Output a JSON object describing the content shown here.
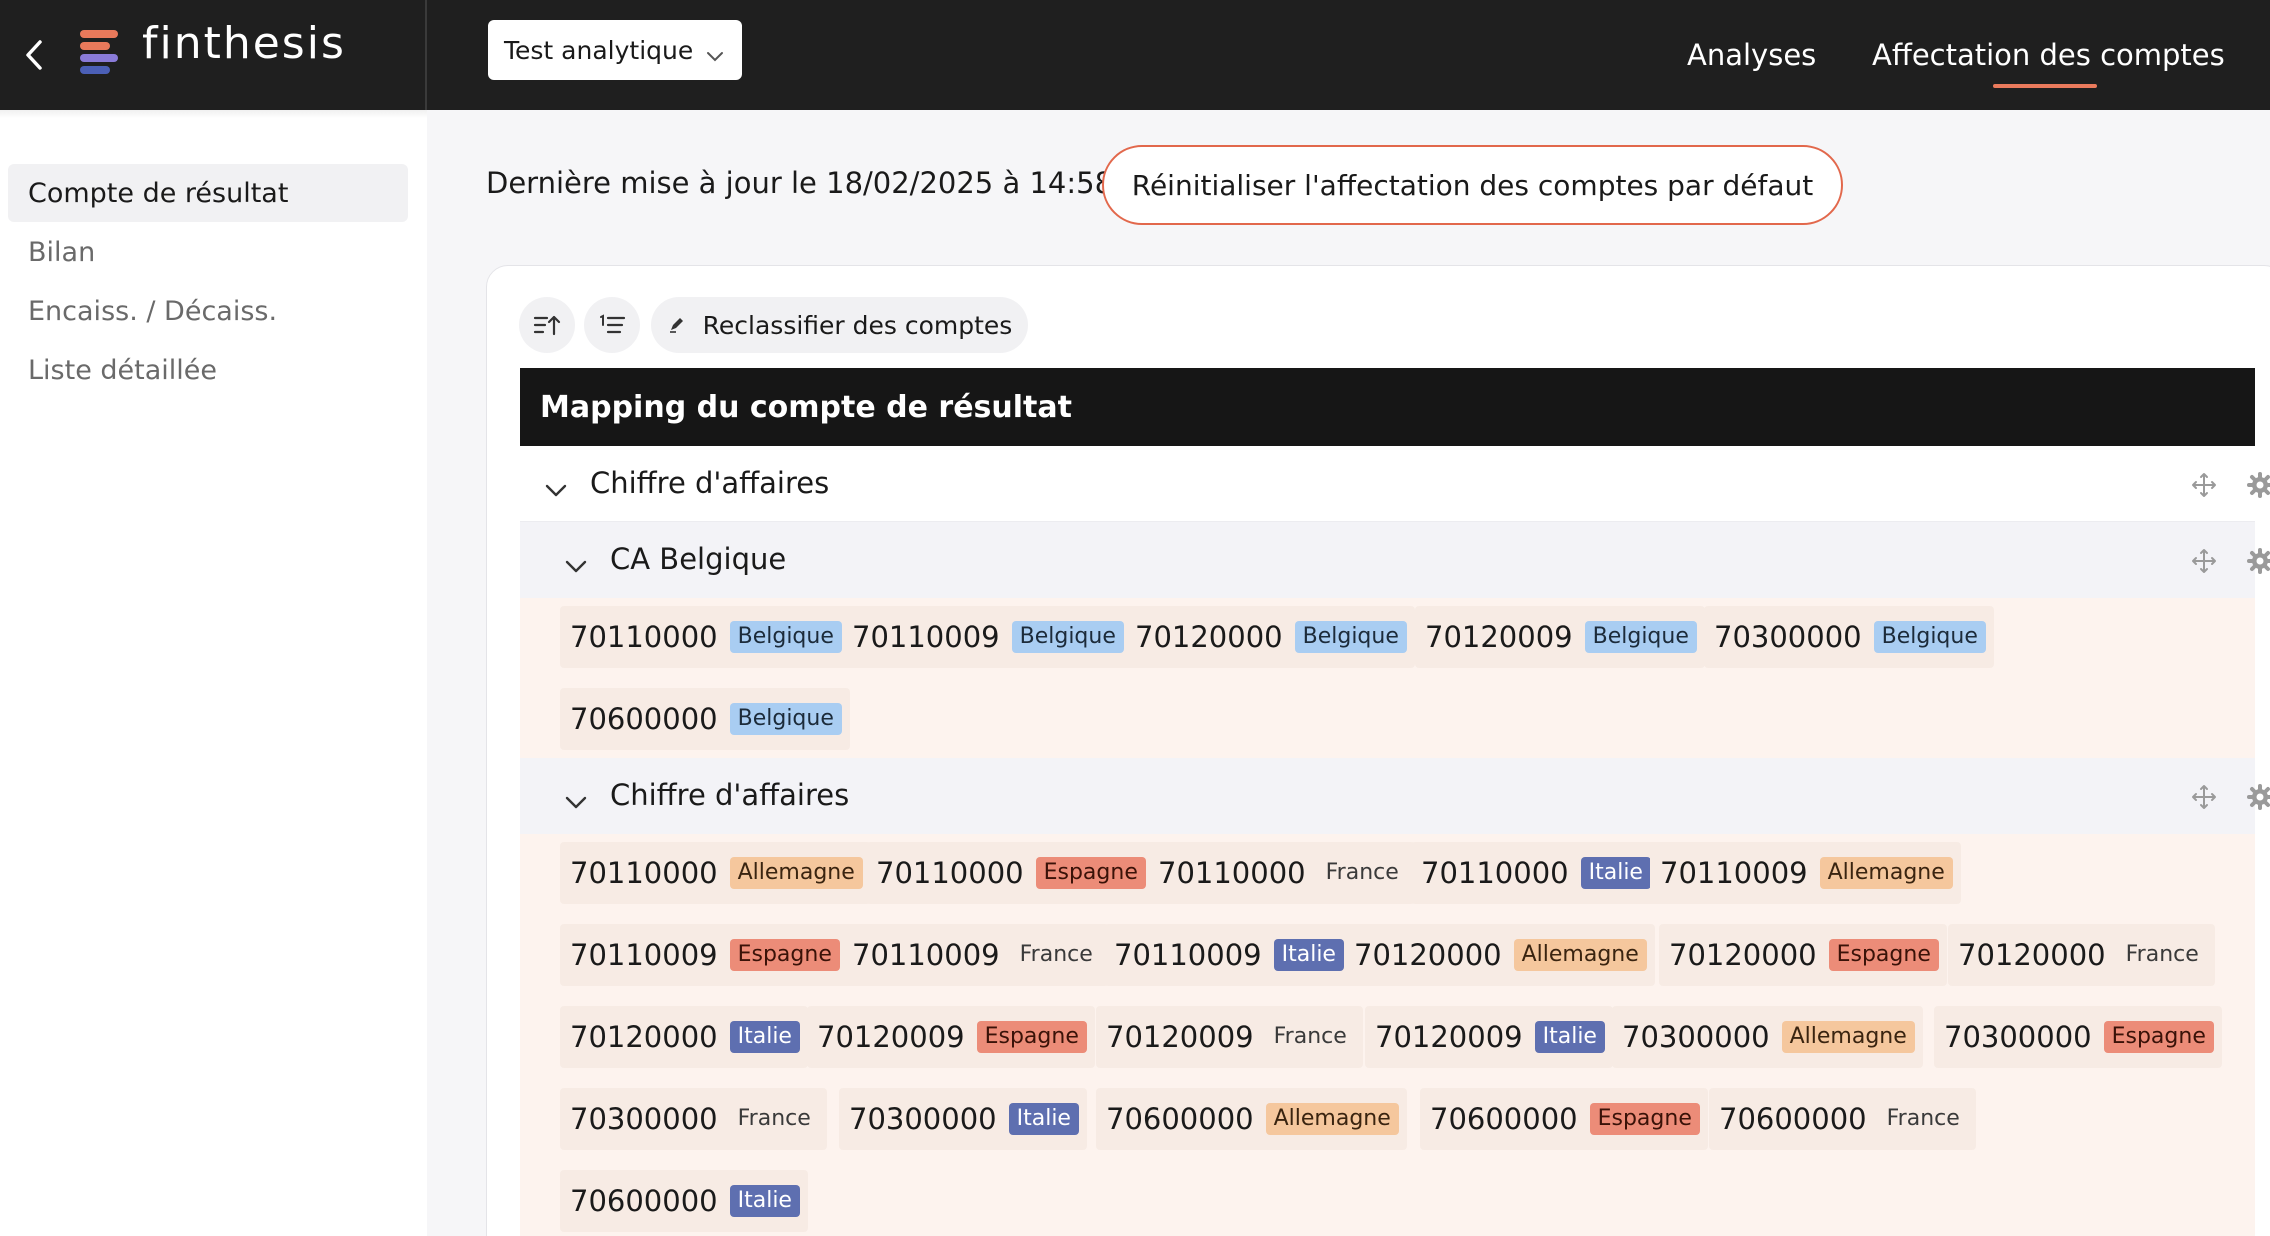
{
  "header": {
    "brand": "finthesis",
    "selector_value": "Test analytique",
    "nav": [
      "Analyses",
      "Affectation des comptes"
    ],
    "active_nav": "Affectation des comptes",
    "logo_colors": [
      "#e9795b",
      "#8a7bd8",
      "#4b5fb6"
    ],
    "accent_color": "#ea7a5c"
  },
  "sidebar": {
    "items": [
      {
        "label": "Compte de résultat",
        "active": true
      },
      {
        "label": "Bilan",
        "active": false
      },
      {
        "label": "Encaiss. / Décaiss.",
        "active": false
      },
      {
        "label": "Liste détaillée",
        "active": false
      }
    ]
  },
  "main": {
    "last_update": "Dernière mise à jour le 18/02/2025 à 14:58",
    "reset_button": "Réinitialiser l'affectation des comptes par défaut",
    "toolbar": {
      "sort_icon": "sort-asc-icon",
      "numbered_list_icon": "numbered-list-icon",
      "reclassify_label": "Reclassifier des comptes",
      "reclassify_icon": "pencil-icon"
    },
    "mapping_title": "Mapping du compte de résultat",
    "groups": [
      {
        "title": "Chiffre d'affaires",
        "level": 1
      },
      {
        "title": "CA Belgique",
        "level": 2,
        "accounts": [
          {
            "number": "70110000",
            "tag": "Belgique"
          },
          {
            "number": "70110009",
            "tag": "Belgique"
          },
          {
            "number": "70120000",
            "tag": "Belgique"
          },
          {
            "number": "70120009",
            "tag": "Belgique"
          },
          {
            "number": "70300000",
            "tag": "Belgique"
          },
          {
            "number": "70600000",
            "tag": "Belgique"
          }
        ]
      },
      {
        "title": "Chiffre d'affaires",
        "level": 2,
        "accounts": [
          {
            "number": "70110000",
            "tag": "Allemagne"
          },
          {
            "number": "70110000",
            "tag": "Espagne"
          },
          {
            "number": "70110000",
            "tag": "France"
          },
          {
            "number": "70110000",
            "tag": "Italie"
          },
          {
            "number": "70110009",
            "tag": "Allemagne"
          },
          {
            "number": "70110009",
            "tag": "Espagne"
          },
          {
            "number": "70110009",
            "tag": "France"
          },
          {
            "number": "70110009",
            "tag": "Italie"
          },
          {
            "number": "70120000",
            "tag": "Allemagne"
          },
          {
            "number": "70120000",
            "tag": "Espagne"
          },
          {
            "number": "70120000",
            "tag": "France"
          },
          {
            "number": "70120000",
            "tag": "Italie"
          },
          {
            "number": "70120009",
            "tag": "Espagne"
          },
          {
            "number": "70120009",
            "tag": "France"
          },
          {
            "number": "70120009",
            "tag": "Italie"
          },
          {
            "number": "70300000",
            "tag": "Allemagne"
          },
          {
            "number": "70300000",
            "tag": "Espagne"
          },
          {
            "number": "70300000",
            "tag": "France"
          },
          {
            "number": "70300000",
            "tag": "Italie"
          },
          {
            "number": "70600000",
            "tag": "Allemagne"
          },
          {
            "number": "70600000",
            "tag": "Espagne"
          },
          {
            "number": "70600000",
            "tag": "France"
          },
          {
            "number": "70600000",
            "tag": "Italie"
          }
        ]
      }
    ]
  },
  "tag_colors": {
    "Belgique": "#a9cdf2",
    "Allemagne": "#f5c79d",
    "Espagne": "#ec8c78",
    "France": "transparent",
    "Italie": "#5e6fb0"
  }
}
